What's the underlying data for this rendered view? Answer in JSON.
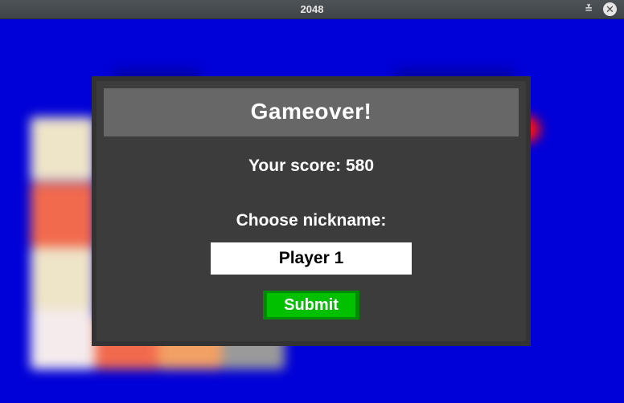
{
  "window": {
    "title": "2048",
    "minimize_glyph": "≚",
    "close_glyph": "✕"
  },
  "colors": {
    "background": "#0000d8",
    "dialog_bg": "#3c3c3c",
    "dialog_header_bg": "#676767",
    "submit_bg": "#00c000",
    "submit_border": "#008a00",
    "tile_cream": "#eee4c8",
    "tile_orange": "#f26a4d",
    "tile_light_orange": "#f2a064",
    "tile_grey": "#9a9a9a",
    "red_accent": "#ff1010"
  },
  "dialog": {
    "title": "Gameover!",
    "score_text": "Your score: 580",
    "nickname_label": "Choose nickname:",
    "nickname_value": "Player 1",
    "submit_label": "Submit"
  },
  "icons": {
    "minimize": "minimize-icon",
    "close": "close-icon"
  }
}
